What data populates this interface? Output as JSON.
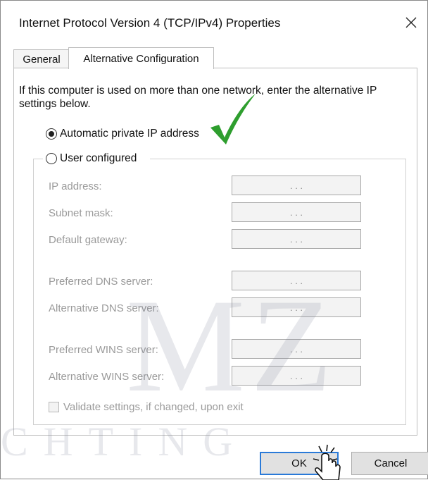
{
  "window": {
    "title": "Internet Protocol Version 4 (TCP/IPv4) Properties",
    "close_glyph": "✕"
  },
  "tabs": [
    {
      "label": "General",
      "active": false
    },
    {
      "label": "Alternative Configuration",
      "active": true
    }
  ],
  "intro_text": "If this computer is used on more than one network, enter the alternative IP settings below.",
  "options": {
    "automatic": {
      "label": "Automatic private IP address",
      "selected": true
    },
    "user": {
      "label": "User configured",
      "selected": false
    }
  },
  "fields": [
    {
      "label": "IP address:",
      "value": ".       .       ."
    },
    {
      "label": "Subnet mask:",
      "value": ".       .       ."
    },
    {
      "label": "Default gateway:",
      "value": ".       .       ."
    },
    {
      "label": "Preferred DNS server:",
      "value": ".       .       ."
    },
    {
      "label": "Alternative DNS server:",
      "value": ".       .       ."
    },
    {
      "label": "Preferred WINS server:",
      "value": ".       .       ."
    },
    {
      "label": "Alternative WINS server:",
      "value": ".       .       ."
    }
  ],
  "validate_checkbox": {
    "label": "Validate settings, if changed, upon exit",
    "checked": false
  },
  "buttons": {
    "ok": "OK",
    "cancel": "Cancel"
  },
  "watermark": {
    "primary": "MZ",
    "secondary": "CHTING"
  },
  "colors": {
    "accent_blue": "#2a7ad8",
    "check_green": "#2e9e2e",
    "disabled_text": "#9a9a9a"
  },
  "icons": {
    "close": "close-icon",
    "annotation": "green-checkmark-icon",
    "cursor": "hand-cursor-icon"
  }
}
